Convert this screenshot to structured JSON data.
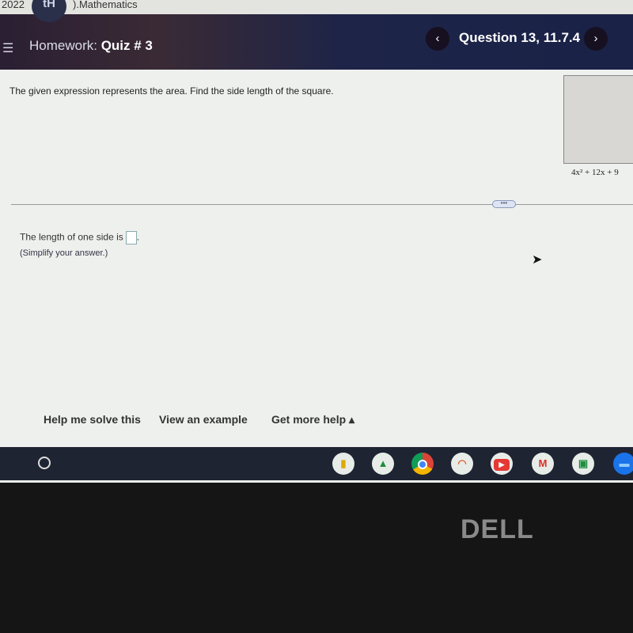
{
  "browser": {
    "tab_text": "2022",
    "doc_title": ").Mathematics",
    "logo_text": "tH"
  },
  "header": {
    "menu_icon": "hamburger-icon",
    "section": "Homework:",
    "title": "Quiz # 3",
    "question": "Question 13, 11.7.4",
    "prev": "‹",
    "next": "›"
  },
  "question": {
    "prompt": "The given expression represents the area. Find the side length of the square.",
    "area_expression": "4x² + 12x + 9",
    "divider_handle": "•••"
  },
  "answer": {
    "label": "The length of one side is",
    "value": "",
    "suffix": ".",
    "hint": "(Simplify your answer.)"
  },
  "help": {
    "solve": "Help me solve this",
    "example": "View an example",
    "more": "Get more help ▴"
  },
  "taskbar": {
    "apps": [
      "keep-icon",
      "drive-icon",
      "chrome-icon",
      "photos-icon",
      "youtube-icon",
      "gmail-icon",
      "classroom-icon",
      "files-icon"
    ]
  },
  "bezel": {
    "brand": "DELL"
  }
}
